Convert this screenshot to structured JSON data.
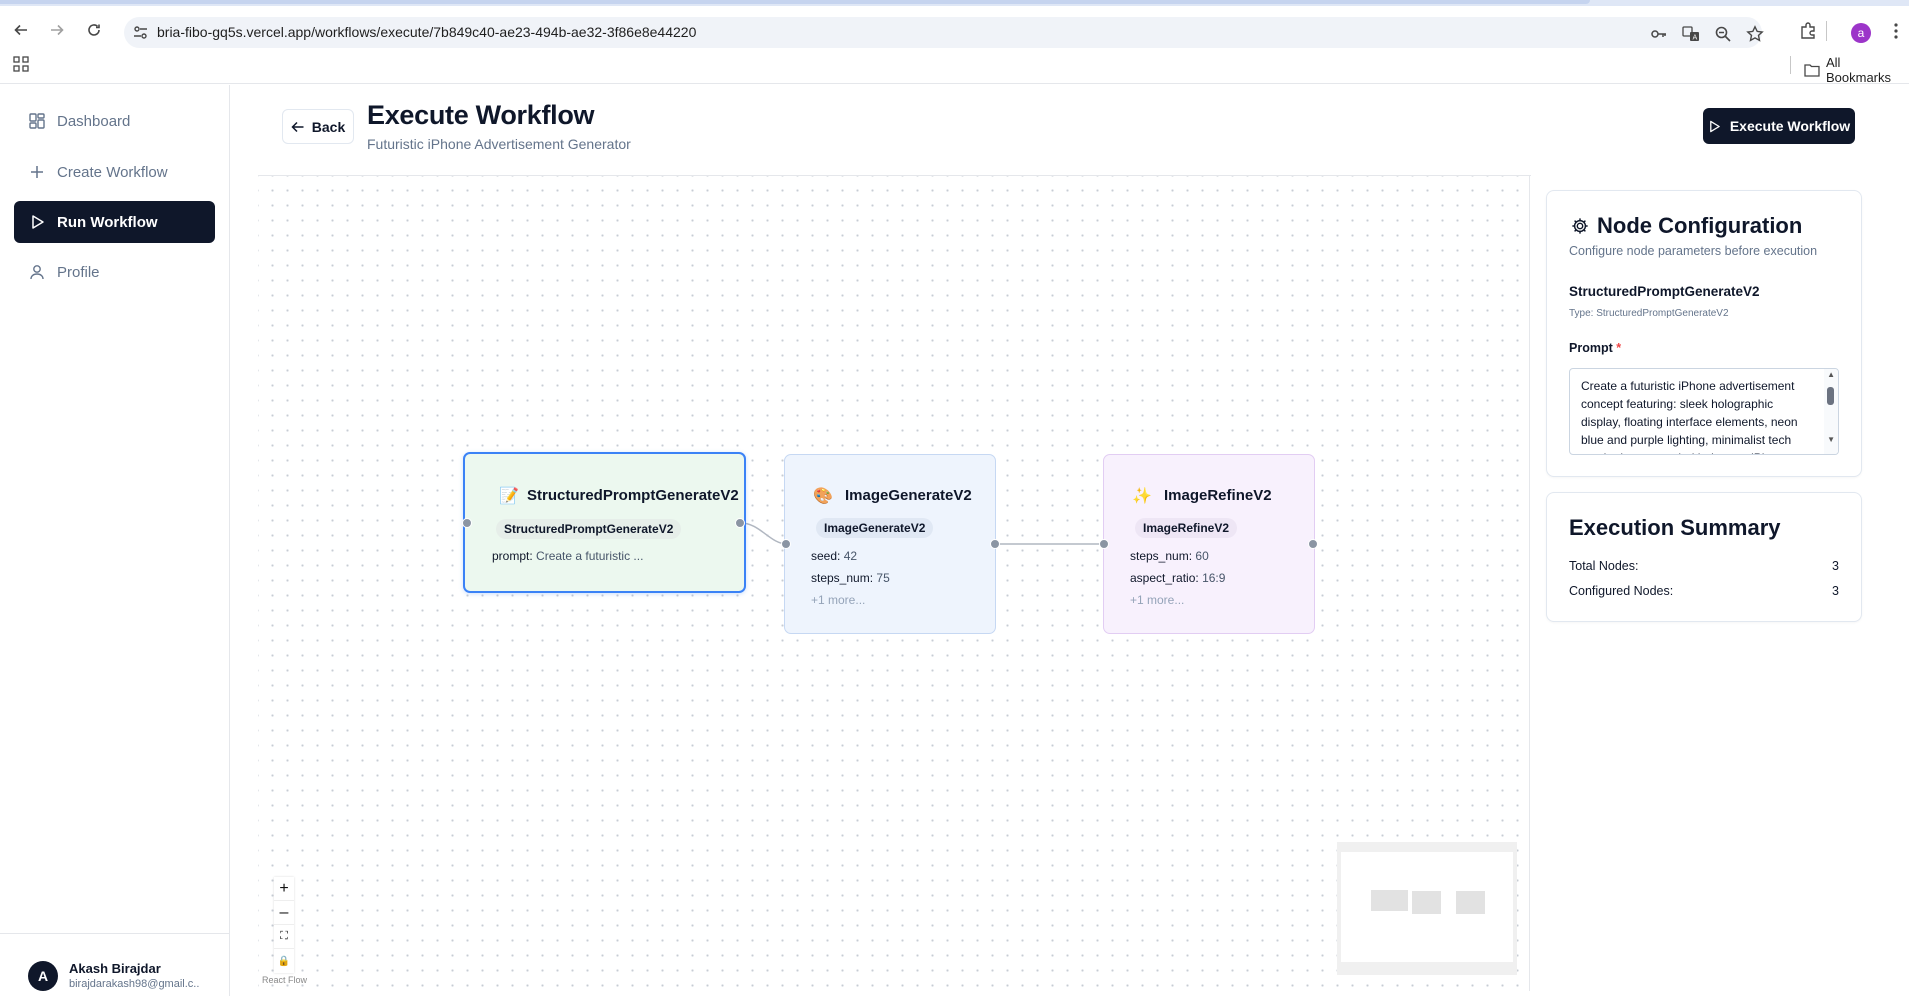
{
  "browser": {
    "url": "bria-fibo-gq5s.vercel.app/workflows/execute/7b849c40-ae23-494b-ae32-3f86e8e44220",
    "all_bookmarks": "All Bookmarks",
    "profile_initial": "a"
  },
  "sidebar": {
    "items": [
      {
        "label": "Dashboard",
        "icon": "dashboard-icon"
      },
      {
        "label": "Create Workflow",
        "icon": "plus-icon"
      },
      {
        "label": "Run Workflow",
        "icon": "play-icon",
        "active": true
      },
      {
        "label": "Profile",
        "icon": "user-icon"
      }
    ],
    "user": {
      "initial": "A",
      "name": "Akash Birajdar",
      "email": "birajdarakash98@gmail.c..."
    }
  },
  "header": {
    "back_label": "Back",
    "title": "Execute Workflow",
    "subtitle": "Futuristic iPhone Advertisement Generator",
    "execute_label": "Execute Workflow"
  },
  "nodes": [
    {
      "emoji": "📝",
      "title": "StructuredPromptGenerateV2",
      "badge": "StructuredPromptGenerateV2",
      "params": [
        {
          "key": "prompt:",
          "value": "Create a futuristic ..."
        }
      ],
      "more": ""
    },
    {
      "emoji": "🎨",
      "title": "ImageGenerateV2",
      "badge": "ImageGenerateV2",
      "params": [
        {
          "key": "seed:",
          "value": "42"
        },
        {
          "key": "steps_num:",
          "value": "75"
        }
      ],
      "more": "+1 more..."
    },
    {
      "emoji": "✨",
      "title": "ImageRefineV2",
      "badge": "ImageRefineV2",
      "params": [
        {
          "key": "steps_num:",
          "value": "60"
        },
        {
          "key": "aspect_ratio:",
          "value": "16:9"
        }
      ],
      "more": "+1 more..."
    }
  ],
  "canvas": {
    "attribution": "React Flow",
    "controls": [
      "+",
      "–",
      "⛶",
      "🔒"
    ]
  },
  "config": {
    "title": "Node Configuration",
    "description": "Configure node parameters before execution",
    "node_name": "StructuredPromptGenerateV2",
    "node_type": "Type: StructuredPromptGenerateV2",
    "prompt_label": "Prompt",
    "prompt_required": "*",
    "prompt_value": "Create a futuristic iPhone advertisement concept featuring: sleek holographic display, floating interface elements, neon blue and purple lighting, minimalist tech aesthetic, suspended hologram iPhone with AR"
  },
  "summary": {
    "title": "Execution Summary",
    "rows": [
      {
        "label": "Total Nodes:",
        "value": "3"
      },
      {
        "label": "Configured Nodes:",
        "value": "3"
      }
    ]
  },
  "colors": {
    "primary": "#0f172a",
    "selected_border": "#3b82f6",
    "node1_bg": "#ecf8ef",
    "node2_bg": "#eef4fd",
    "node3_bg": "#f8f1fd",
    "required": "#ef4444"
  }
}
